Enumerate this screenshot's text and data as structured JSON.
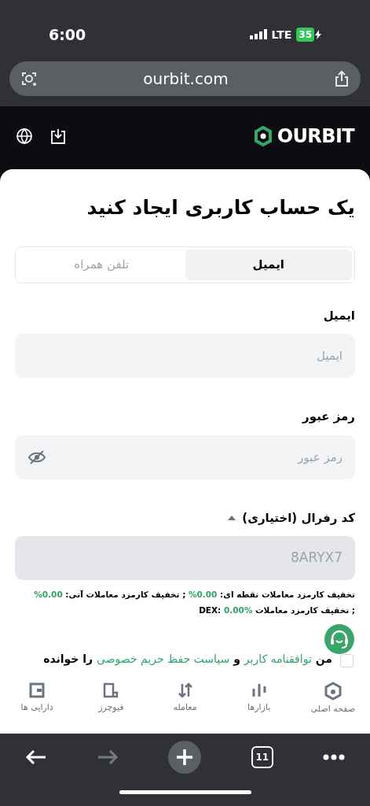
{
  "status_bar": {
    "time": "6:00",
    "network": "LTE",
    "battery": "35"
  },
  "browser": {
    "url": "ourbit.com",
    "tab_count": "11"
  },
  "header": {
    "logo": "OURBIT"
  },
  "form": {
    "title": "یک حساب کاربری ایجاد کنید",
    "tabs": [
      {
        "label": "ایمیل",
        "selected": true
      },
      {
        "label": "تلفن همراه",
        "selected": false
      }
    ],
    "fields": [
      {
        "kind": "text",
        "label": "ایمیل",
        "placeholder": "ایمیل"
      },
      {
        "kind": "password",
        "label": "رمز عبور",
        "placeholder": "رمز عبور"
      }
    ],
    "referral": {
      "label": "کد رفرال (اختیاری)",
      "expanded": true,
      "value": "8ARYX7",
      "disabled": true
    },
    "fees": [
      {
        "label": "تخفیف کارمزد معاملات نقطه ای:",
        "value": "0.00%"
      },
      {
        "label": "; تخفیف کارمزد معاملات آتی:",
        "value": "0.00%"
      },
      {
        "label": "; تخفیف کارمزد معاملات DEX:",
        "value": "0.00%"
      }
    ],
    "agreement": {
      "checked": false,
      "parts": [
        {
          "kind": "text",
          "text": "من"
        },
        {
          "kind": "link",
          "text": "توافقنامه کاربر"
        },
        {
          "kind": "text",
          "text": "و"
        },
        {
          "kind": "link",
          "text": "سیاست حفظ حریم خصوصی"
        },
        {
          "kind": "text",
          "text": "را خوانده"
        }
      ]
    }
  },
  "bottom_nav": [
    {
      "kind": "home",
      "label": "صفحه اصلی"
    },
    {
      "kind": "markets",
      "label": "بازارها"
    },
    {
      "kind": "trade",
      "label": "معامله"
    },
    {
      "kind": "futures",
      "label": "فیوچرز"
    },
    {
      "kind": "assets",
      "label": "دارایی ها"
    }
  ]
}
